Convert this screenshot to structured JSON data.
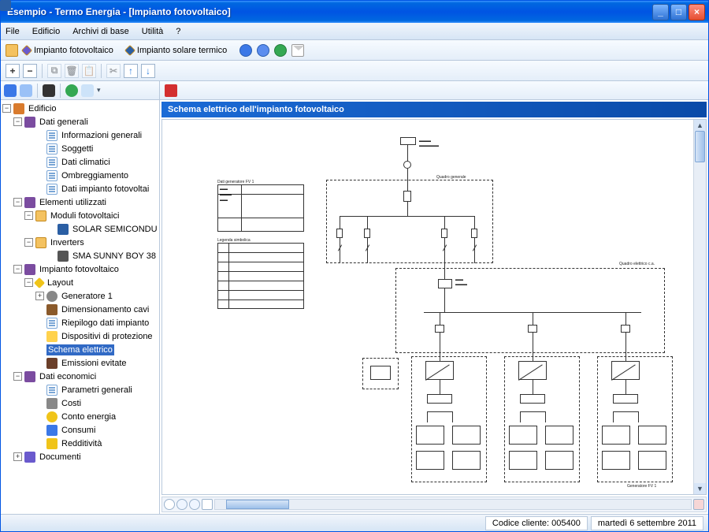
{
  "window": {
    "title": "Esempio - Termo Energia - [Impianto fotovoltaico]"
  },
  "menu": {
    "file": "File",
    "edificio": "Edificio",
    "archivi": "Archivi di base",
    "utilita": "Utilità",
    "help": "?"
  },
  "toolbar": {
    "pv": "Impianto fotovoltaico",
    "solar": "Impianto solare termico"
  },
  "tree": {
    "root": "Edificio",
    "dati_generali": "Dati generali",
    "info_generali": "Informazioni generali",
    "soggetti": "Soggetti",
    "dati_climatici": "Dati climatici",
    "ombreggiamento": "Ombreggiamento",
    "dati_impianto_pv": "Dati impianto fotovoltai",
    "elementi": "Elementi utilizzati",
    "moduli": "Moduli fotovoltaici",
    "solar_module": "SOLAR SEMICONDU",
    "inverters": "Inverters",
    "sma": "SMA SUNNY BOY 38",
    "impianto_pv": "Impianto fotovoltaico",
    "layout": "Layout",
    "generatore": "Generatore 1",
    "cavi": "Dimensionamento cavi",
    "riepilogo": "Riepilogo dati impianto",
    "protezione": "Dispositivi di protezione",
    "schema": "Schema elettrico",
    "emissioni": "Emissioni evitate",
    "economici": "Dati economici",
    "parametri": "Parametri generali",
    "costi": "Costi",
    "conto": "Conto energia",
    "consumi": "Consumi",
    "redditivita": "Redditività",
    "documenti": "Documenti"
  },
  "panel": {
    "title": "Schema elettrico dell'impianto fotovoltaico"
  },
  "diagram": {
    "legend_title": "Legenda simbolica",
    "databox_title": "Dati generatore FV 1",
    "quadro_generale": "Quadro generale",
    "quadro_elettrico": "Quadro elettrico c.a.",
    "generatore_fv": "Generatore FV 1"
  },
  "status": {
    "codice": "Codice cliente: 005400",
    "date": "martedì 6 settembre 2011"
  }
}
